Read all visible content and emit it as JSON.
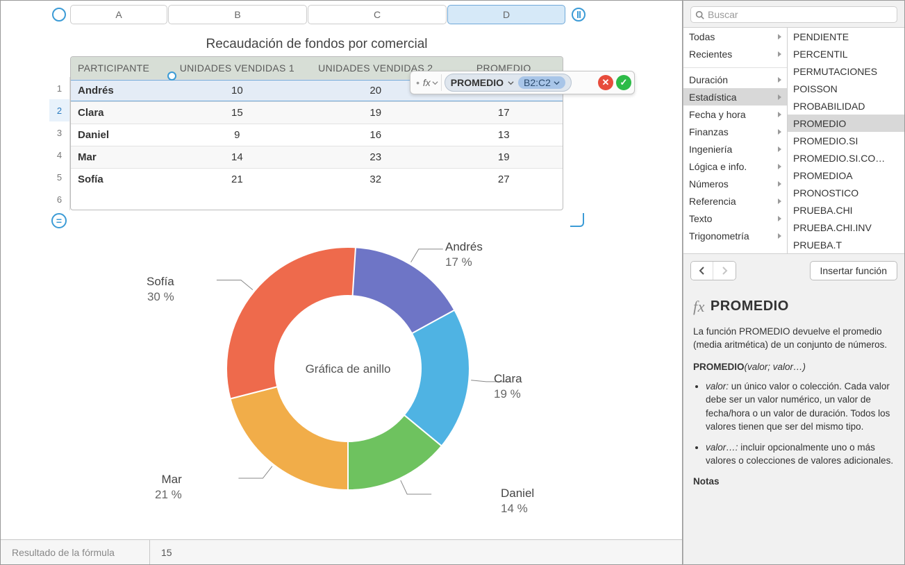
{
  "columns": [
    "A",
    "B",
    "C",
    "D"
  ],
  "table": {
    "title": "Recaudación de fondos por comercial",
    "headers": [
      "PARTICIPANTE",
      "UNIDADES VENDIDAS 1",
      "UNIDADES VENDIDAS 2",
      "PROMEDIO"
    ],
    "rows": [
      {
        "n": "1"
      },
      {
        "n": "2",
        "c": [
          "Andrés",
          "10",
          "20",
          ""
        ]
      },
      {
        "n": "3",
        "c": [
          "Clara",
          "15",
          "19",
          "17"
        ]
      },
      {
        "n": "4",
        "c": [
          "Daniel",
          "9",
          "16",
          "13"
        ]
      },
      {
        "n": "5",
        "c": [
          "Mar",
          "14",
          "23",
          "19"
        ]
      },
      {
        "n": "6",
        "c": [
          "Sofía",
          "21",
          "32",
          "27"
        ]
      }
    ]
  },
  "formula": {
    "fn": "PROMEDIO",
    "range": "B2:C2"
  },
  "chart_data": {
    "type": "donut",
    "title": "Gráfica de anillo",
    "categories": [
      "Andrés",
      "Clara",
      "Daniel",
      "Mar",
      "Sofía"
    ],
    "values": [
      17,
      19,
      14,
      21,
      30
    ],
    "unit": "%",
    "colors": [
      "#6e75c6",
      "#4fb3e3",
      "#6ec25f",
      "#f1ad49",
      "#ee6a4c"
    ]
  },
  "chart_labels": {
    "andres": {
      "name": "Andrés",
      "pct": "17 %"
    },
    "clara": {
      "name": "Clara",
      "pct": "19 %"
    },
    "daniel": {
      "name": "Daniel",
      "pct": "14 %"
    },
    "mar": {
      "name": "Mar",
      "pct": "21 %"
    },
    "sofia": {
      "name": "Sofía",
      "pct": "30 %"
    },
    "center": "Gráfica de anillo"
  },
  "statusbar": {
    "label": "Resultado de la fórmula",
    "value": "15"
  },
  "sidebar": {
    "search_placeholder": "Buscar",
    "categories": [
      "Todas",
      "Recientes",
      "—",
      "Duración",
      "Estadística",
      "Fecha y hora",
      "Finanzas",
      "Ingeniería",
      "Lógica e info.",
      "Números",
      "Referencia",
      "Texto",
      "Trigonometría"
    ],
    "selected_category": "Estadística",
    "functions": [
      "PENDIENTE",
      "PERCENTIL",
      "PERMUTACIONES",
      "POISSON",
      "PROBABILIDAD",
      "PROMEDIO",
      "PROMEDIO.SI",
      "PROMEDIO.SI.CO…",
      "PROMEDIOA",
      "PRONOSTICO",
      "PRUEBA.CHI",
      "PRUEBA.CHI.INV",
      "PRUEBA.T"
    ],
    "selected_function": "PROMEDIO",
    "insert_label": "Insertar función",
    "help": {
      "name": "PROMEDIO",
      "desc": "La función PROMEDIO devuelve el promedio (media aritmética) de un conjunto de números.",
      "sig_prefix": "PROMEDIO",
      "sig_args": "(valor; valor…)",
      "b1_lead": "valor:",
      "b1": " un único valor o colección. Cada valor debe ser un valor numérico, un valor de fecha/hora o un valor de duración. Todos los valores tienen que ser del mismo tipo.",
      "b2_lead": "valor…:",
      "b2": " incluir opcionalmente uno o más valores o colecciones de valores adicionales.",
      "notes": "Notas"
    }
  }
}
